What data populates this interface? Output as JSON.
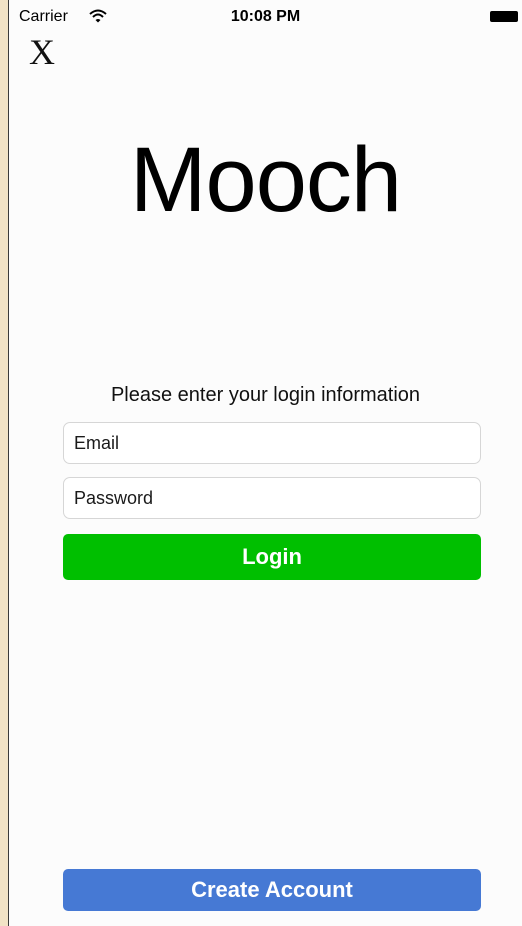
{
  "status_bar": {
    "carrier": "Carrier",
    "time": "10:08 PM",
    "wifi_icon": "wifi-icon",
    "battery_icon": "battery-icon"
  },
  "close": {
    "label": "X"
  },
  "app": {
    "title": "Mooch"
  },
  "login_form": {
    "prompt": "Please enter your login information",
    "email_placeholder": "Email",
    "password_placeholder": "Password",
    "login_label": "Login"
  },
  "footer": {
    "create_account_label": "Create Account"
  },
  "colors": {
    "login_button": "#00bf00",
    "create_account_button": "#4679d4",
    "background": "#fcfcfc"
  }
}
